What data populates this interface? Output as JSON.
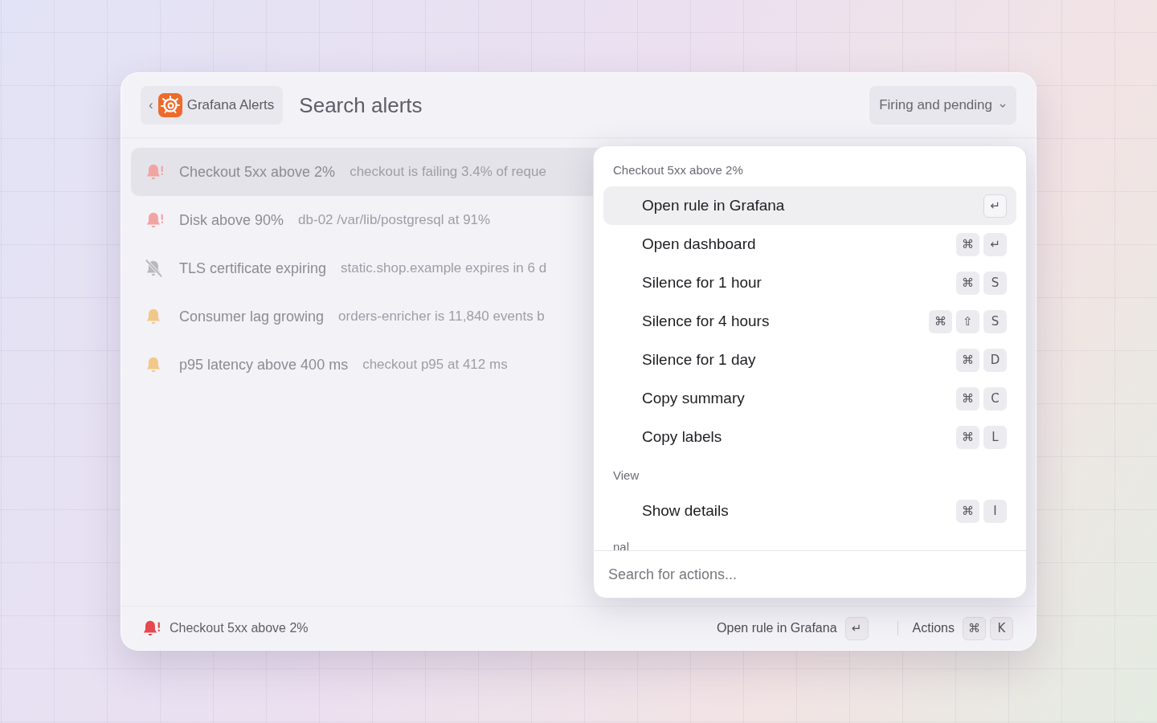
{
  "header": {
    "back": "‹",
    "app": "Grafana Alerts",
    "title": "Search alerts",
    "filter": "Firing and pending"
  },
  "alerts": [
    {
      "title": "Checkout 5xx above 2%",
      "description": "checkout is failing 3.4% of reque",
      "kind": "firing",
      "selected": true
    },
    {
      "title": "Disk above 90%",
      "description": "db-02 /var/lib/postgresql at 91%",
      "kind": "firing",
      "selected": false
    },
    {
      "title": "TLS certificate expiring",
      "description": "static.shop.example expires in 6 d",
      "kind": "silenced",
      "selected": false
    },
    {
      "title": "Consumer lag growing",
      "description": "orders-enricher is 11,840 events b",
      "kind": "pending",
      "selected": false
    },
    {
      "title": "p95 latency above 400 ms",
      "description": "checkout p95 at 412 ms",
      "kind": "pending",
      "selected": false
    }
  ],
  "actions_panel": {
    "sections": [
      {
        "heading": "Checkout 5xx above 2%",
        "items": [
          {
            "label": "Open rule in Grafana",
            "keys": [
              "↵"
            ],
            "selected": true
          },
          {
            "label": "Open dashboard",
            "keys": [
              "⌘",
              "↵"
            ],
            "selected": false
          },
          {
            "label": "Silence for 1 hour",
            "keys": [
              "⌘",
              "S"
            ],
            "selected": false
          },
          {
            "label": "Silence for 4 hours",
            "keys": [
              "⌘",
              "⇧",
              "S"
            ],
            "selected": false
          },
          {
            "label": "Silence for 1 day",
            "keys": [
              "⌘",
              "D"
            ],
            "selected": false
          },
          {
            "label": "Copy summary",
            "keys": [
              "⌘",
              "C"
            ],
            "selected": false
          },
          {
            "label": "Copy labels",
            "keys": [
              "⌘",
              "L"
            ],
            "selected": false
          }
        ]
      },
      {
        "heading": "View",
        "items": [
          {
            "label": "Show details",
            "keys": [
              "⌘",
              "I"
            ],
            "selected": false
          }
        ]
      },
      {
        "heading": "nal"
      }
    ],
    "search": {
      "placeholder": "Search for actions..."
    }
  },
  "footer": {
    "kind": "firing",
    "alert": "Checkout 5xx above 2%",
    "primary": {
      "label": "Open rule in Grafana",
      "keys": [
        "↵"
      ]
    },
    "actions": {
      "label": "Actions",
      "keys": [
        "⌘",
        "K"
      ]
    }
  }
}
